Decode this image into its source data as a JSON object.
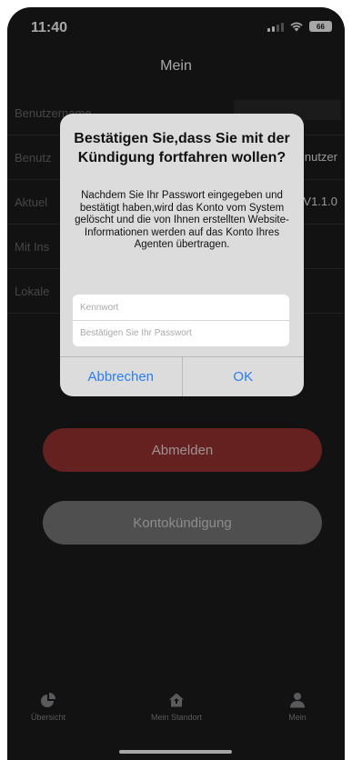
{
  "status_bar": {
    "time": "11:40",
    "battery": "66"
  },
  "nav": {
    "title": "Mein"
  },
  "settings": [
    {
      "label": "Benutzername",
      "value": ""
    },
    {
      "label": "Benutz",
      "value": "nutzer"
    },
    {
      "label": "Aktuel",
      "value": "V1.1.0"
    },
    {
      "label": "Mit Ins",
      "value": ""
    },
    {
      "label": "Lokale",
      "value": ""
    }
  ],
  "buttons": {
    "logout": "Abmelden",
    "cancel_account": "Kontokündigung"
  },
  "dialog": {
    "title": "Bestätigen Sie,dass Sie mit der Kündigung fortfahren wollen?",
    "message": "Nachdem Sie Ihr Passwort eingegeben und bestätigt haben,wird das Konto vom System gelöscht und die von Ihnen erstellten Website-Informationen werden auf das Konto Ihres Agenten übertragen.",
    "password_placeholder": "Kennwort",
    "confirm_placeholder": "Bestätigen Sie Ihr Passwort",
    "cancel_label": "Abbrechen",
    "ok_label": "OK"
  },
  "tabs": [
    {
      "label": "Übersicht",
      "icon": "pie-chart-icon"
    },
    {
      "label": "Mein Standort",
      "icon": "house-icon"
    },
    {
      "label": "Mein",
      "icon": "person-icon"
    }
  ],
  "colors": {
    "background": "#1c1c1e",
    "logout_button": "#9b3432",
    "cancel_account_button": "#7a7a7a",
    "dialog_background": "#dcdcdc",
    "dialog_action": "#2a7ef0"
  }
}
